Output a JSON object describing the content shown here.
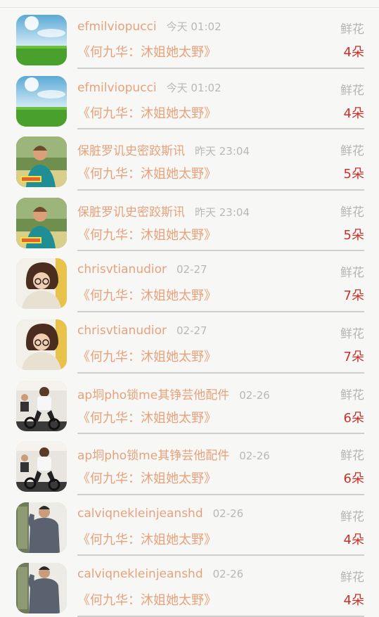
{
  "items": [
    {
      "user": "efmilviopucci",
      "time": "今天 01:02",
      "gift": "鲜花",
      "title": "《何九华：沐姐她太野》",
      "count": "4朵",
      "avatar": "sky-field-avatar"
    },
    {
      "user": "efmilviopucci",
      "time": "今天 01:02",
      "gift": "鲜花",
      "title": "《何九华：沐姐她太野》",
      "count": "4朵",
      "avatar": "sky-field-avatar"
    },
    {
      "user": "保脏罗讥史密跤斯讯",
      "time": "昨天 23:04",
      "gift": "鲜花",
      "title": "《何九华：沐姐她太野》",
      "count": "5朵",
      "avatar": "boy-outdoor-avatar"
    },
    {
      "user": "保脏罗讥史密跤斯讯",
      "time": "昨天 23:04",
      "gift": "鲜花",
      "title": "《何九华：沐姐她太野》",
      "count": "5朵",
      "avatar": "boy-outdoor-avatar"
    },
    {
      "user": "chrisvtianudior",
      "time": "02-27",
      "gift": "鲜花",
      "title": "《何九华：沐姐她太野》",
      "count": "7朵",
      "avatar": "girl-glasses-avatar"
    },
    {
      "user": "chrisvtianudior",
      "time": "02-27",
      "gift": "鲜花",
      "title": "《何九华：沐姐她太野》",
      "count": "7朵",
      "avatar": "girl-glasses-avatar"
    },
    {
      "user": "ap垌pho锁me其铮芸他配件",
      "time": "02-26",
      "gift": "鲜花",
      "title": "《何九华：沐姐她太野》",
      "count": "6朵",
      "avatar": "gym-cycling-avatar"
    },
    {
      "user": "ap垌pho锁me其铮芸他配件",
      "time": "02-26",
      "gift": "鲜花",
      "title": "《何九华：沐姐她太野》",
      "count": "6朵",
      "avatar": "gym-cycling-avatar"
    },
    {
      "user": "calviqnekleinjeanshd",
      "time": "02-26",
      "gift": "鲜花",
      "title": "《何九华：沐姐她太野》",
      "count": "4朵",
      "avatar": "man-sweater-avatar"
    },
    {
      "user": "calviqnekleinjeanshd",
      "time": "02-26",
      "gift": "鲜花",
      "title": "《何九华：沐姐她太野》",
      "count": "4朵",
      "avatar": "man-sweater-avatar"
    }
  ],
  "colors": {
    "username": "#e7a27b",
    "time": "#b8b8b8",
    "gift": "#b5b5b5",
    "count": "#c8322b",
    "divider": "#cfcfcf"
  }
}
